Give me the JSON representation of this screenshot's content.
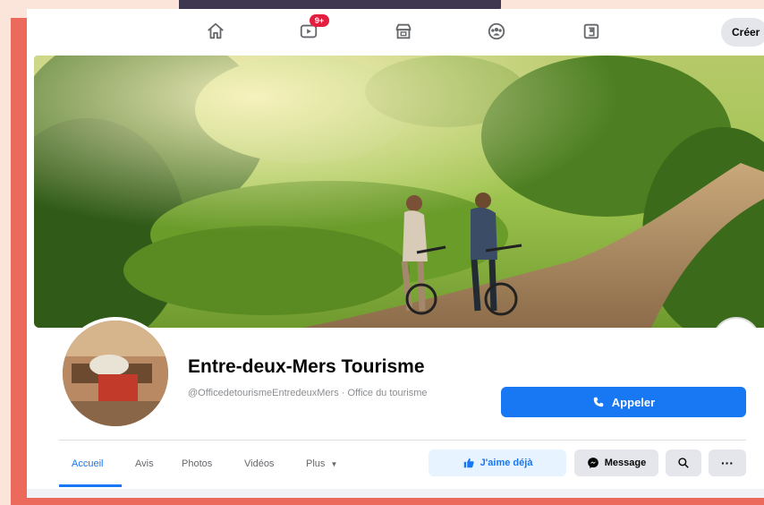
{
  "nav": {
    "notification_badge": "9+",
    "create_label": "Créer",
    "icons": [
      "home-icon",
      "watch-icon",
      "marketplace-icon",
      "groups-icon",
      "gaming-icon"
    ]
  },
  "page": {
    "name": "Entre-deux-Mers Tourisme",
    "subtitle": "@OfficedetourismeEntredeuxMers · Office du tourisme",
    "call_button": "Appeler"
  },
  "tabs": [
    "Accueil",
    "Avis",
    "Photos",
    "Vidéos",
    "Plus"
  ],
  "actions": {
    "like_label": "J'aime déjà",
    "message_label": "Message",
    "more_label": "···"
  },
  "colors": {
    "accent": "#1877f2",
    "frame": "#ec6a5c",
    "badge": "#e41e3f"
  }
}
